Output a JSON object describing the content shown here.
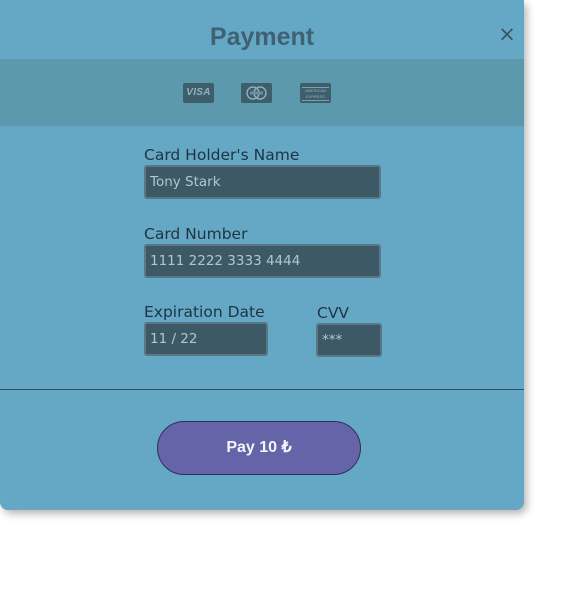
{
  "modal": {
    "title": "Payment",
    "close_label": "×"
  },
  "card_logos": [
    {
      "name": "visa",
      "text": "VISA"
    },
    {
      "name": "mastercard"
    },
    {
      "name": "american-express",
      "text": "AMERICAN EXPRESS"
    }
  ],
  "form": {
    "holder_name": {
      "label": "Card Holder's Name",
      "value": "Tony Stark"
    },
    "card_number": {
      "label": "Card Number",
      "value": "1111 2222 3333 4444"
    },
    "expiration": {
      "label": "Expiration Date",
      "value": "11 / 22"
    },
    "cvv": {
      "label": "CVV",
      "value": "***"
    }
  },
  "pay_button": {
    "label": "Pay 10 ₺"
  },
  "colors": {
    "modal_bg": "#64a8c6",
    "strip_bg": "#5c99ad",
    "input_bg": "#3e5966",
    "button_bg": "#6564a8",
    "title_color": "#3f6172"
  }
}
